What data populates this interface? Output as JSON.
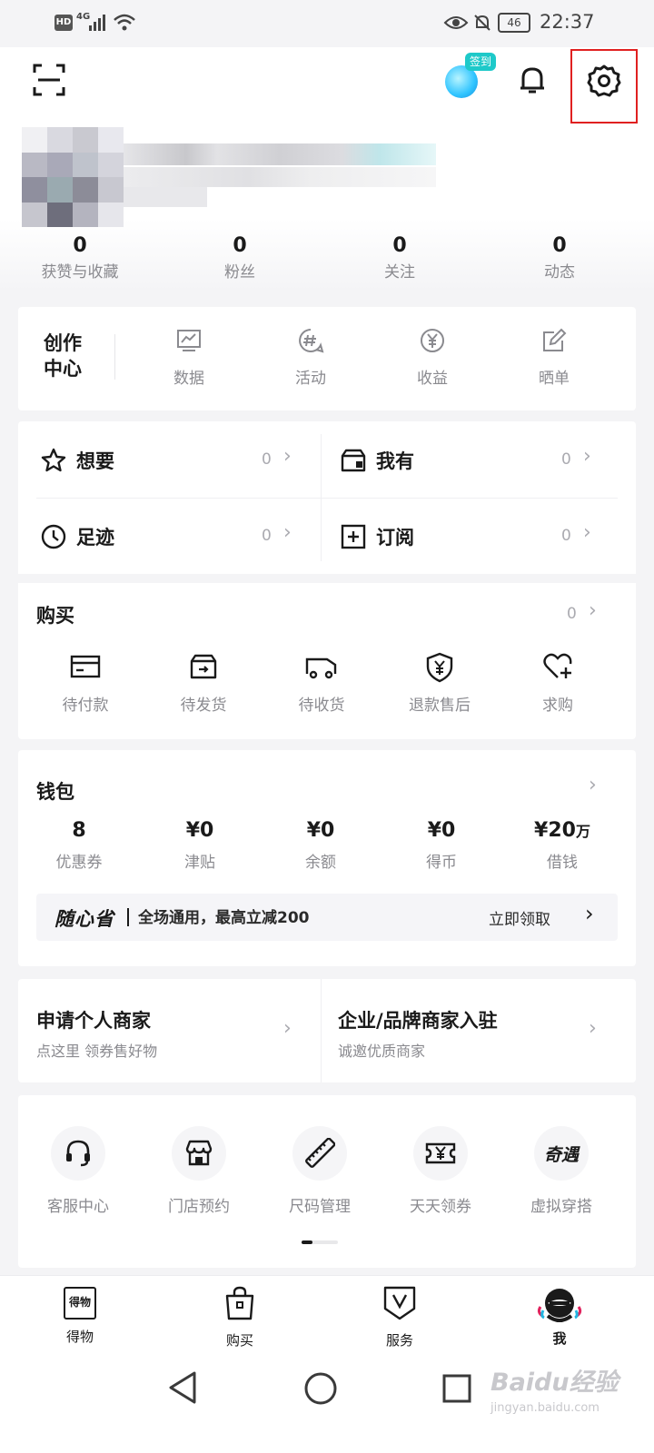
{
  "status_bar": {
    "hd": "HD",
    "net": "4G",
    "battery": "46",
    "time": "22:37"
  },
  "header": {
    "checkin_label": "签到"
  },
  "stats": [
    {
      "value": "0",
      "label": "获赞与收藏"
    },
    {
      "value": "0",
      "label": "粉丝"
    },
    {
      "value": "0",
      "label": "关注"
    },
    {
      "value": "0",
      "label": "动态"
    }
  ],
  "creator": {
    "title_line1": "创作",
    "title_line2": "中心",
    "items": [
      {
        "icon": "chart-icon",
        "label": "数据"
      },
      {
        "icon": "hashtag-icon",
        "label": "活动"
      },
      {
        "icon": "yen-circle-icon",
        "label": "收益"
      },
      {
        "icon": "edit-icon",
        "label": "晒单"
      }
    ]
  },
  "collections": [
    {
      "icon": "star-icon",
      "label": "想要",
      "count": "0"
    },
    {
      "icon": "box-icon",
      "label": "我有",
      "count": "0"
    },
    {
      "icon": "clock-icon",
      "label": "足迹",
      "count": "0"
    },
    {
      "icon": "plus-square-icon",
      "label": "订阅",
      "count": "0"
    }
  ],
  "purchase": {
    "title": "购买",
    "count": "0",
    "items": [
      {
        "icon": "card-icon",
        "label": "待付款"
      },
      {
        "icon": "package-icon",
        "label": "待发货"
      },
      {
        "icon": "truck-icon",
        "label": "待收货"
      },
      {
        "icon": "shield-yen-icon",
        "label": "退款售后"
      },
      {
        "icon": "heart-plus-icon",
        "label": "求购"
      }
    ]
  },
  "wallet": {
    "title": "钱包",
    "items": [
      {
        "value": "8",
        "unit": "",
        "label": "优惠券"
      },
      {
        "value": "¥0",
        "unit": "",
        "label": "津贴"
      },
      {
        "value": "¥0",
        "unit": "",
        "label": "余额"
      },
      {
        "value": "¥0",
        "unit": "",
        "label": "得币"
      },
      {
        "value": "¥20",
        "unit": "万",
        "label": "借钱"
      }
    ],
    "promo": {
      "brand": "随心省",
      "text": "全场通用，最高立减200",
      "action": "立即领取"
    }
  },
  "merchant": [
    {
      "title": "申请个人商家",
      "subtitle": "点这里 领券售好物"
    },
    {
      "title": "企业/品牌商家入驻",
      "subtitle": "诚邀优质商家"
    }
  ],
  "services": [
    {
      "icon": "headset-icon",
      "label": "客服中心"
    },
    {
      "icon": "store-icon",
      "label": "门店预约"
    },
    {
      "icon": "ruler-icon",
      "label": "尺码管理"
    },
    {
      "icon": "ticket-icon",
      "label": "天天领券"
    },
    {
      "icon": "qiyu-icon",
      "glyph": "奇遇",
      "label": "虚拟穿搭"
    }
  ],
  "tabbar": [
    {
      "icon": "dewu-icon",
      "glyph": "得物",
      "label": "得物"
    },
    {
      "icon": "bag-icon",
      "label": "购买"
    },
    {
      "icon": "service-v-icon",
      "label": "服务"
    },
    {
      "icon": "avatar-icon",
      "label": "我"
    }
  ],
  "watermark": {
    "text": "Baidu经验",
    "sub": "jingyan.baidu.com"
  }
}
